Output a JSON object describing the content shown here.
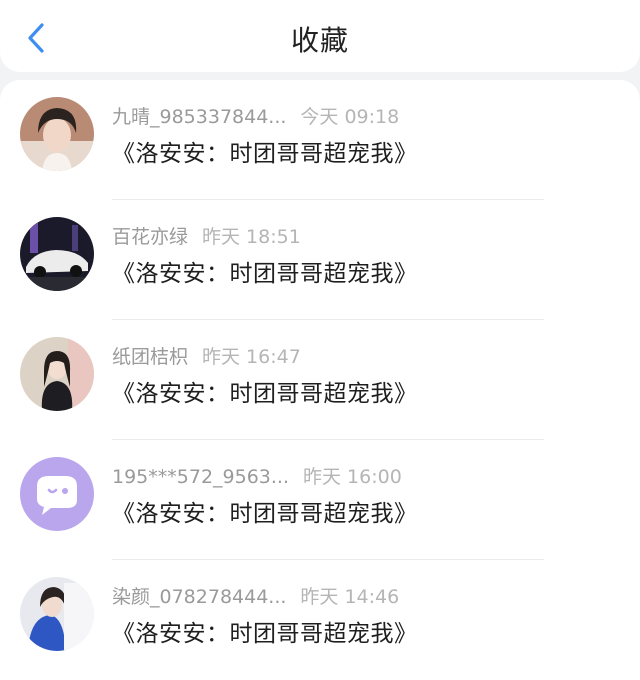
{
  "header": {
    "title": "收藏",
    "back_icon": "chevron-left-icon",
    "accent_color": "#3d8ef0"
  },
  "items": [
    {
      "name": "九晴_985337844...",
      "time": "今天 09:18",
      "content": "《洛安安：时团哥哥超宠我》",
      "avatar": "portrait-photo"
    },
    {
      "name": "百花亦绿",
      "time": "昨天 18:51",
      "content": "《洛安安：时团哥哥超宠我》",
      "avatar": "car-photo"
    },
    {
      "name": "纸团桔枳",
      "time": "昨天 16:47",
      "content": "《洛安安：时团哥哥超宠我》",
      "avatar": "girl-photo"
    },
    {
      "name": "195***572_9563...",
      "time": "昨天 16:00",
      "content": "《洛安安：时团哥哥超宠我》",
      "avatar": "default-chat-avatar"
    },
    {
      "name": "染颜_078278444...",
      "time": "昨天 14:46",
      "content": "《洛安安：时团哥哥超宠我》",
      "avatar": "winter-photo"
    }
  ]
}
